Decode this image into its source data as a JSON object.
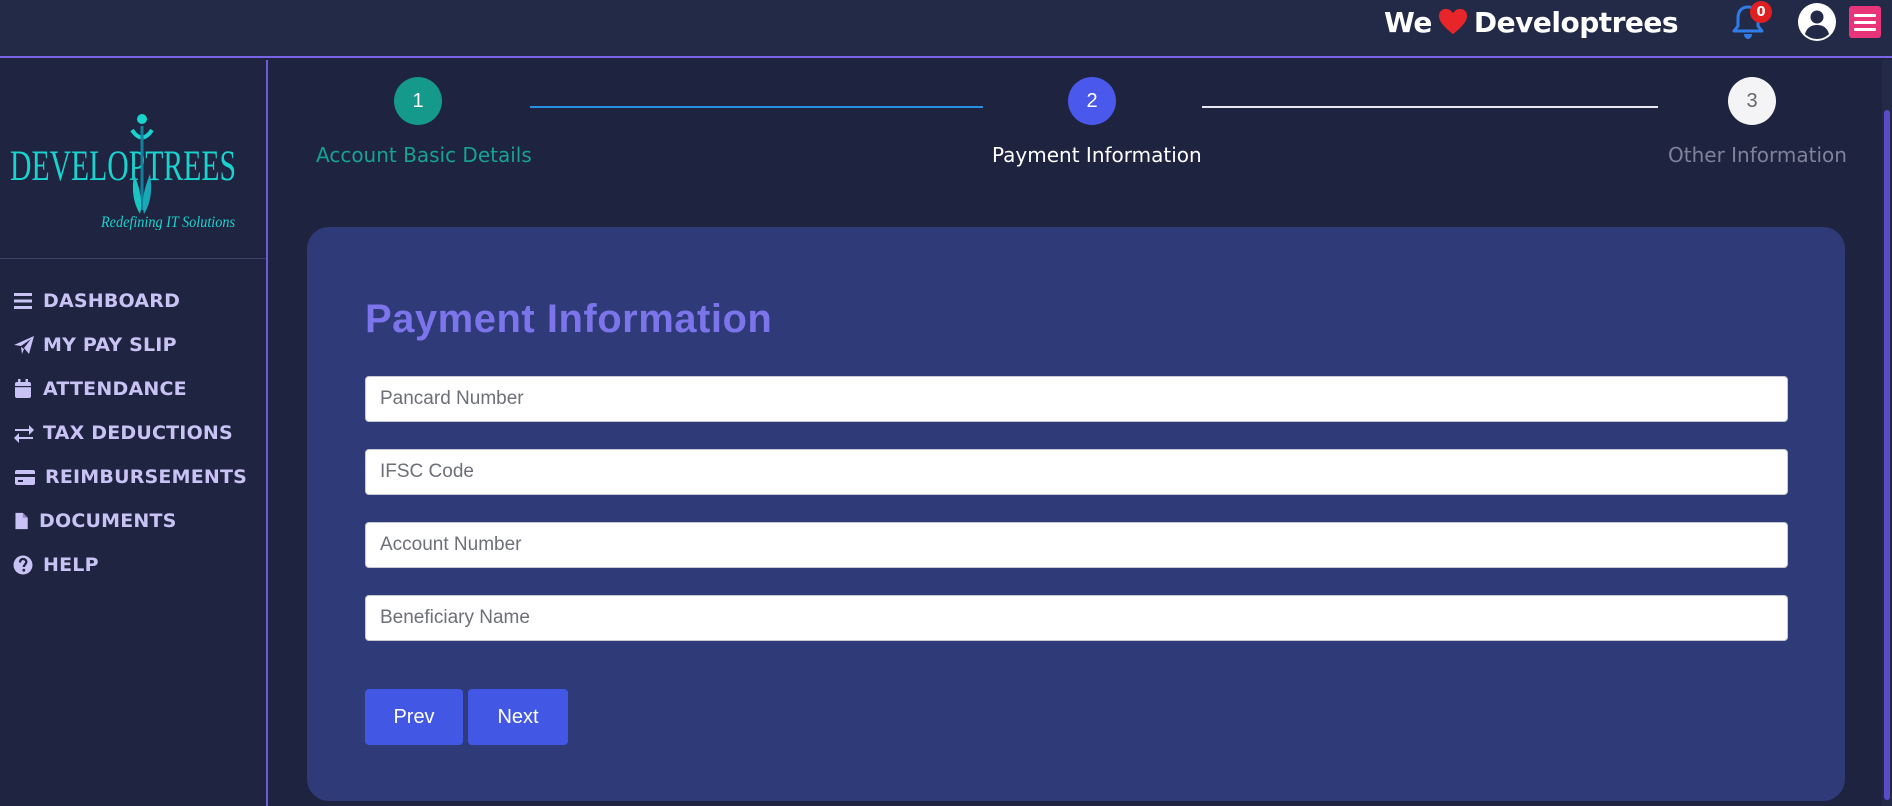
{
  "header": {
    "tagline_pre": "We",
    "tagline_brand": "Developtrees",
    "notification_count": "0"
  },
  "sidebar": {
    "logo_text": "DEVELOPTREES",
    "logo_subtitle": "Redefining IT Solutions",
    "items": [
      {
        "label": "DASHBOARD",
        "icon": "bars-icon"
      },
      {
        "label": "MY PAY SLIP",
        "icon": "paper-plane-icon"
      },
      {
        "label": "ATTENDANCE",
        "icon": "calendar-icon"
      },
      {
        "label": "TAX DEDUCTIONS",
        "icon": "exchange-icon"
      },
      {
        "label": "REIMBURSEMENTS",
        "icon": "credit-card-icon"
      },
      {
        "label": "DOCUMENTS",
        "icon": "file-icon"
      },
      {
        "label": "HELP",
        "icon": "question-circle-icon"
      }
    ]
  },
  "steps": [
    {
      "number": "1",
      "label": "Account Basic Details",
      "state": "completed",
      "color": "#14998a"
    },
    {
      "number": "2",
      "label": "Payment Information",
      "state": "active",
      "color": "#4a58ec"
    },
    {
      "number": "3",
      "label": "Other Information",
      "state": "pending",
      "color": "#f4f4f6"
    }
  ],
  "form": {
    "title": "Payment Information",
    "fields": [
      {
        "placeholder": "Pancard Number",
        "value": ""
      },
      {
        "placeholder": "IFSC Code",
        "value": ""
      },
      {
        "placeholder": "Account Number",
        "value": ""
      },
      {
        "placeholder": "Beneficiary Name",
        "value": ""
      }
    ],
    "prev_label": "Prev",
    "next_label": "Next"
  },
  "colors": {
    "accent": "#7a64e6",
    "button": "#4258e4",
    "menu_toggle": "#e8357a",
    "heart": "#e8262a",
    "bell": "#2f7de8"
  }
}
